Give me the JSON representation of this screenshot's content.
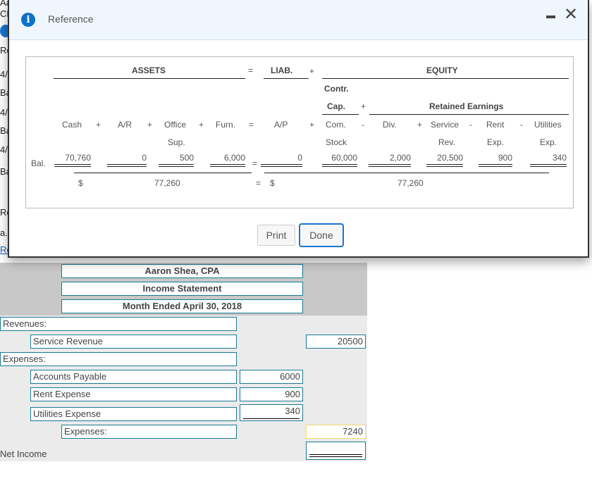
{
  "background_page": {
    "fragments": [
      "Aa",
      "CF",
      "Re",
      "4/",
      "Ba",
      "4/",
      "Ba",
      "4/",
      "Ba",
      "Re",
      "a.",
      "Re"
    ]
  },
  "modal": {
    "title": "Reference",
    "icons": {
      "info": "info-icon",
      "minimize": "minimize-icon",
      "close": "close-icon"
    },
    "close_glyph": "✕",
    "info_glyph": "i",
    "equation": {
      "header_assets": "ASSETS",
      "header_eq": "=",
      "header_liab": "LIAB.",
      "header_plus": "+",
      "header_equity": "EQUITY",
      "contr_line1": "Contr.",
      "contr_line2": "Cap.",
      "contr_plus": "+",
      "retained_earnings": "Retained Earnings",
      "columns": [
        {
          "label1": "Cash",
          "label2": "",
          "value": "70,760"
        },
        {
          "label1": "A/R",
          "label2": "",
          "value": "0"
        },
        {
          "label1": "Office",
          "label2": "Sup.",
          "value": "500"
        },
        {
          "label1": "Furn.",
          "label2": "",
          "value": "6,000"
        },
        {
          "label1": "A/P",
          "label2": "",
          "value": "0"
        },
        {
          "label1": "Com.",
          "label2": "Stock",
          "value": "60,000"
        },
        {
          "label1": "Div.",
          "label2": "",
          "value": "2,000"
        },
        {
          "label1": "Service",
          "label2": "Rev.",
          "value": "20,500"
        },
        {
          "label1": "Rent",
          "label2": "Exp.",
          "value": "900"
        },
        {
          "label1": "Utilities",
          "label2": "Exp.",
          "value": "340"
        }
      ],
      "operators": [
        "+",
        "+",
        "+",
        "=",
        "+",
        "-",
        "+",
        "-",
        "-"
      ],
      "bal_label": "Bal.",
      "bal_eq": "=",
      "total_left_currency": "$",
      "total_left": "77,260",
      "total_eq": "=",
      "total_right_currency": "$",
      "total_right": "77,260"
    },
    "buttons": {
      "print": "Print",
      "done": "Done"
    }
  },
  "income_statement": {
    "company": "Aaron Shea, CPA",
    "title": "Income Statement",
    "period": "Month Ended April 30, 2018",
    "revenues_label": "Revenues:",
    "revenue_items": [
      {
        "label": "Service Revenue",
        "amount": "20500"
      }
    ],
    "expenses_label": "Expenses:",
    "expense_items": [
      {
        "label": "Accounts Payable",
        "amount": "6000"
      },
      {
        "label": "Rent Expense",
        "amount": "900"
      },
      {
        "label": "Utilities Expense",
        "amount": "340"
      }
    ],
    "total_expenses_label": "Expenses:",
    "total_expenses_amount": "7240",
    "net_income_label": "Net Income",
    "net_income_amount": ""
  }
}
